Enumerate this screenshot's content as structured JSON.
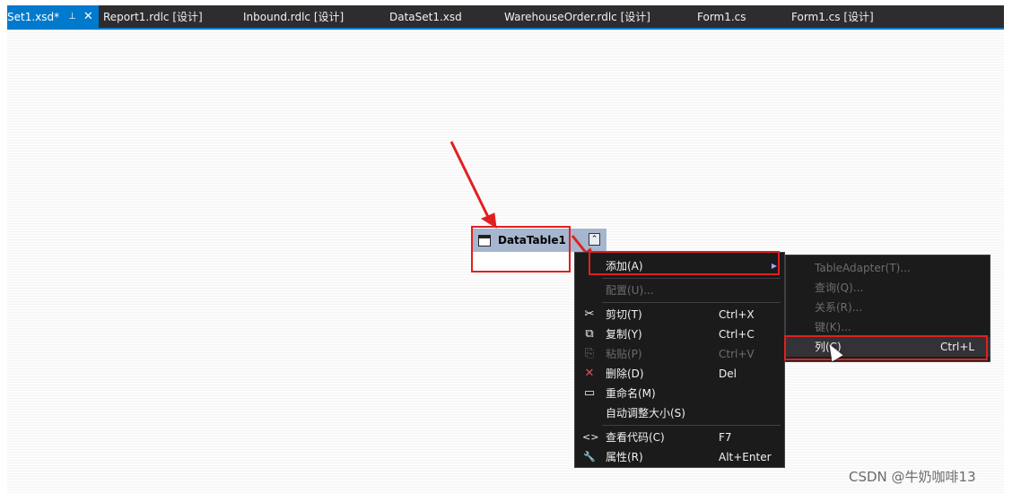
{
  "tabs": [
    {
      "label": "Set1.xsd*",
      "active": true
    },
    {
      "label": "Report1.rdlc [设计]"
    },
    {
      "label": "Inbound.rdlc [设计]"
    },
    {
      "label": "DataSet1.xsd"
    },
    {
      "label": "WarehouseOrder.rdlc [设计]"
    },
    {
      "label": "Form1.cs"
    },
    {
      "label": "Form1.cs [设计]"
    }
  ],
  "tab_pin_glyph": "⊥",
  "tab_close_glyph": "✕",
  "datatable": {
    "title": "DataTable1",
    "collapse_glyph": "⌃"
  },
  "context_menu": {
    "items": [
      {
        "label": "添加(A)",
        "icon": "",
        "shortcut": ""
      },
      {
        "label": "配置(U)...",
        "icon": "",
        "shortcut": ""
      },
      {
        "label": "剪切(T)",
        "icon": "scissors-icon",
        "glyph": "✂",
        "shortcut": "Ctrl+X"
      },
      {
        "label": "复制(Y)",
        "icon": "copy-icon",
        "glyph": "⧉",
        "shortcut": "Ctrl+C"
      },
      {
        "label": "粘贴(P)",
        "icon": "paste-icon",
        "glyph": "⎘",
        "shortcut": "Ctrl+V"
      },
      {
        "label": "删除(D)",
        "icon": "delete-icon",
        "glyph": "✕",
        "shortcut": "Del"
      },
      {
        "label": "重命名(M)",
        "icon": "rename-icon",
        "glyph": "▭",
        "shortcut": ""
      },
      {
        "label": "自动调整大小(S)",
        "icon": "",
        "shortcut": ""
      },
      {
        "label": "查看代码(C)",
        "icon": "code-icon",
        "glyph": "<>",
        "shortcut": "F7"
      },
      {
        "label": "属性(R)",
        "icon": "wrench-icon",
        "glyph": "🔧",
        "shortcut": "Alt+Enter"
      }
    ]
  },
  "submenu": {
    "items": [
      {
        "label": "TableAdapter(T)...",
        "shortcut": ""
      },
      {
        "label": "查询(Q)...",
        "shortcut": ""
      },
      {
        "label": "关系(R)...",
        "shortcut": ""
      },
      {
        "label": "键(K)...",
        "shortcut": ""
      },
      {
        "label": "列(C)",
        "shortcut": "Ctrl+L"
      }
    ]
  },
  "watermark": "CSDN @牛奶咖啡13",
  "colors": {
    "accent": "#007acc",
    "highlight_red": "#e02020",
    "menu_bg": "#1b1b1c",
    "table_header": "#a6b6ce"
  }
}
